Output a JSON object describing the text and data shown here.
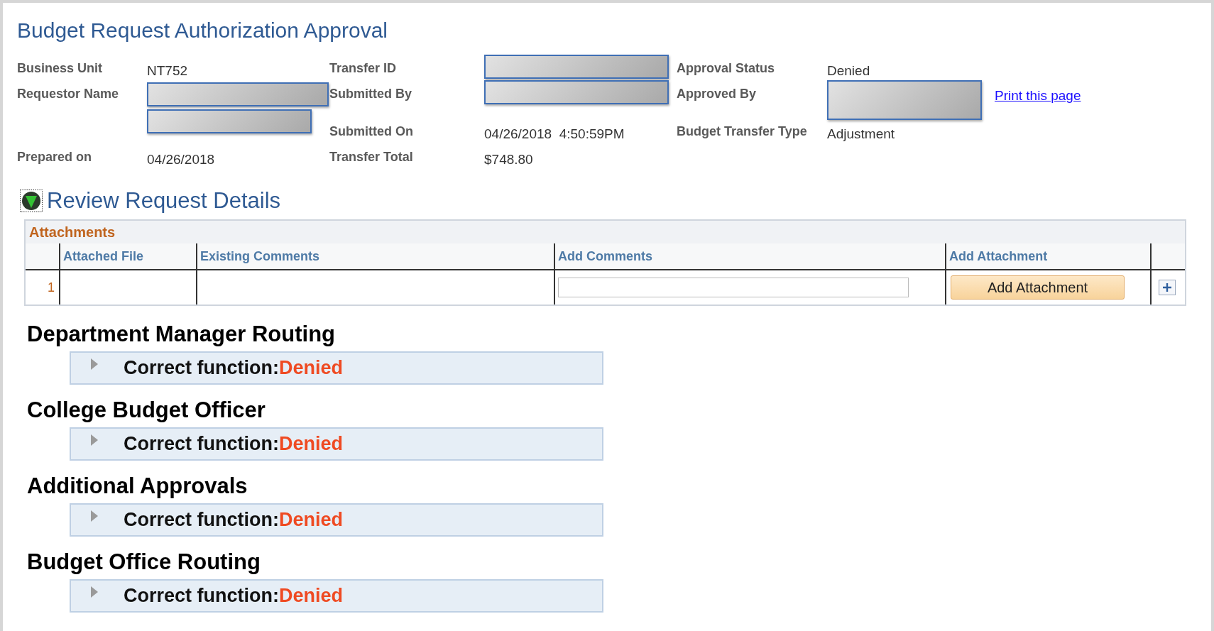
{
  "page_title": "Budget Request Authorization Approval",
  "summary": [
    {
      "kind": "text",
      "label": "Business Unit",
      "value": "NT752"
    },
    {
      "kind": "redacted",
      "label": "Transfer ID"
    },
    {
      "kind": "text",
      "label": "Approval Status",
      "value": "Denied"
    },
    {
      "kind": "redacted2",
      "label": "Requestor Name"
    },
    {
      "kind": "redacted",
      "label": "Submitted By"
    },
    {
      "kind": "redactedtall",
      "label": "Approved By",
      "link": "Print this page"
    },
    {
      "kind": "text",
      "label": "Submitted On",
      "value": "04/26/2018  4:50:59PM"
    },
    {
      "kind": "text",
      "label": "Budget Transfer Type",
      "value": "Adjustment"
    },
    {
      "kind": "text",
      "label": "Prepared on",
      "value": "04/26/2018"
    },
    {
      "kind": "text",
      "label": "Transfer Total",
      "value": "$748.80"
    }
  ],
  "review": {
    "title": "Review Request Details",
    "expanded": true
  },
  "attachments": {
    "title": "Attachments",
    "columns": [
      "Attached File",
      "Existing Comments",
      "Add Comments",
      "Add Attachment"
    ],
    "rows": [
      {
        "number": "1",
        "button": "Add Attachment"
      }
    ]
  },
  "routings": [
    {
      "heading": "Department Manager Routing",
      "label": "Correct function:",
      "status": "Denied",
      "expanded": false
    },
    {
      "heading": "College Budget Officer",
      "label": "Correct function:",
      "status": "Denied",
      "expanded": false
    },
    {
      "heading": "Additional Approvals",
      "label": "Correct function:",
      "status": "Denied",
      "expanded": false
    },
    {
      "heading": "Budget Office Routing",
      "label": "Correct function:",
      "status": "Denied",
      "expanded": false
    }
  ]
}
